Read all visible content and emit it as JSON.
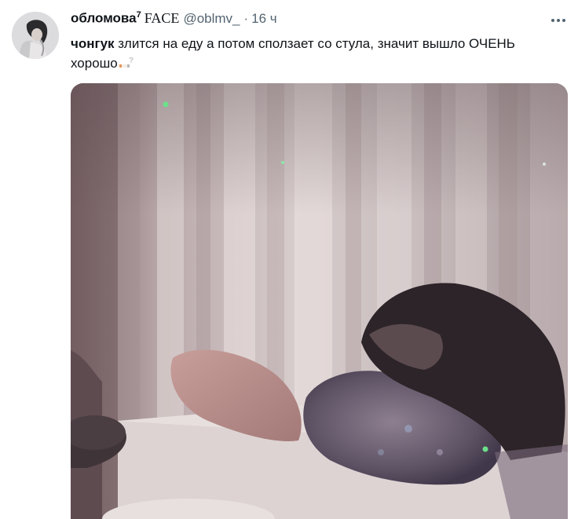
{
  "tweet": {
    "author": {
      "name": "обломова",
      "superscript": "7",
      "name_extra": "FACE",
      "handle": "@oblmv_",
      "separator": "·",
      "time": "16 ч"
    },
    "text": {
      "bold_lead": "чонгук",
      "body": " злится на еду а потом сползает со стула, значит вышло ОЧЕНЬ хорошо"
    },
    "icons": {
      "more": "more-dots-icon",
      "emoji": "cigarette-question-emoji"
    }
  }
}
